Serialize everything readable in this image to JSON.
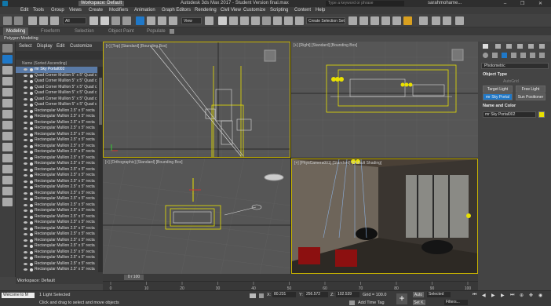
{
  "window": {
    "workspace_label": "Workspace: Default",
    "title": "Autodesk 3ds Max 2017 - Student Version    final.max",
    "search_placeholder": "Type a keyword or phrase",
    "user": "sarahmohame...",
    "controls": "– ❐ ✕"
  },
  "menu": [
    "Edit",
    "Tools",
    "Group",
    "Views",
    "Create",
    "Modifiers",
    "Animation",
    "Graph Editors",
    "Rendering",
    "Civil View",
    "Customize",
    "Scripting",
    "Content",
    "Help"
  ],
  "toolbar": {
    "filter_value": "All",
    "view_value": "View",
    "selection_set_placeholder": "Create Selection Set"
  },
  "ribbon": {
    "tabs": [
      "Modeling",
      "Freeform",
      "Selection",
      "Object Paint",
      "Populate"
    ],
    "active_tab": "Modeling",
    "subtab": "Polygon Modeling"
  },
  "scene_explorer": {
    "tabs": [
      "Select",
      "Display",
      "Edit",
      "Customize"
    ],
    "column_header": "Name (Sorted Ascending)",
    "rows": [
      "mr Sky Portal002",
      "Quad Corner Mullion 5\" x 5\" Quad c",
      "Quad Corner Mullion 5\" x 5\" Quad c",
      "Quad Corner Mullion 5\" x 5\" Quad c",
      "Quad Corner Mullion 5\" x 5\" Quad c",
      "Quad Corner Mullion 5\" x 5\" Quad c",
      "Quad Corner Mullion 5\" x 5\" Quad c",
      "Rectangular Mullion 2.5\" x 5\" recta",
      "Rectangular Mullion 2.5\" x 5\" recta",
      "Rectangular Mullion 2.5\" x 5\" recta",
      "Rectangular Mullion 2.5\" x 5\" recta",
      "Rectangular Mullion 2.5\" x 5\" recta",
      "Rectangular Mullion 2.5\" x 5\" recta",
      "Rectangular Mullion 2.5\" x 5\" recta",
      "Rectangular Mullion 2.5\" x 5\" recta",
      "Rectangular Mullion 2.5\" x 5\" recta",
      "Rectangular Mullion 2.5\" x 5\" recta",
      "Rectangular Mullion 2.5\" x 5\" recta",
      "Rectangular Mullion 2.5\" x 5\" recta",
      "Rectangular Mullion 2.5\" x 5\" recta",
      "Rectangular Mullion 2.5\" x 5\" recta",
      "Rectangular Mullion 2.5\" x 5\" recta",
      "Rectangular Mullion 2.5\" x 5\" recta",
      "Rectangular Mullion 2.5\" x 5\" recta",
      "Rectangular Mullion 2.5\" x 5\" recta",
      "Rectangular Mullion 2.5\" x 5\" recta",
      "Rectangular Mullion 2.5\" x 5\" recta",
      "Rectangular Mullion 2.5\" x 5\" recta",
      "Rectangular Mullion 2.5\" x 5\" recta",
      "Rectangular Mullion 2.5\" x 5\" recta",
      "Rectangular Mullion 2.5\" x 5\" recta",
      "Rectangular Mullion 2.5\" x 5\" recta",
      "Rectangular Mullion 2.5\" x 5\" recta",
      "Rectangular Mullion 2.5\" x 5\" recta",
      "Rectangular Mullion 2.5\" x 5\" recta"
    ],
    "workspace_footer": "Workspace: Default"
  },
  "viewports": {
    "top": "[+] [Top] [Standard] [Bounding Box]",
    "right": "[+] [Right] [Standard] [Bounding Box]",
    "ortho": "[+] [Orthographic] [Standard] [Bounding Box]",
    "camera": "[+] [PhysCamera001] [Standard] [Default Shading]"
  },
  "command_panel": {
    "dropdown_value": "Photometric",
    "object_type_title": "Object Type",
    "autogrid": "AutoGrid",
    "buttons": [
      "Target Light",
      "Free Light",
      "mr Sky Portal",
      "Sun Positioner"
    ],
    "name_color_title": "Name and Color",
    "name_value": "mr Sky Portal002",
    "swatch_color": "#e8e000"
  },
  "timeline": {
    "frame_label": "0 / 100",
    "ticks": [
      "0",
      "10",
      "20",
      "30",
      "40",
      "50",
      "60",
      "70",
      "80",
      "90",
      "100"
    ]
  },
  "status": {
    "welcome": "Welcome to M",
    "selection_info": "1 Light Selected",
    "prompt": "Click and drag to select and move objects",
    "x_label": "X:",
    "x_value": "80.231",
    "y_label": "Y:",
    "y_value": "256.572",
    "z_label": "Z:",
    "z_value": "102.539",
    "grid": "Grid = 100.0",
    "add_time_tag": "Add Time Tag",
    "auto_label": "Auto",
    "selected_value": "Selected",
    "setk_label": "Set K.",
    "filters_label": "Filters..."
  },
  "colors": {
    "accent_blue": "#1f78c8",
    "selection_yellow": "#ffea00",
    "viewport_active_border": "#c8b400"
  }
}
